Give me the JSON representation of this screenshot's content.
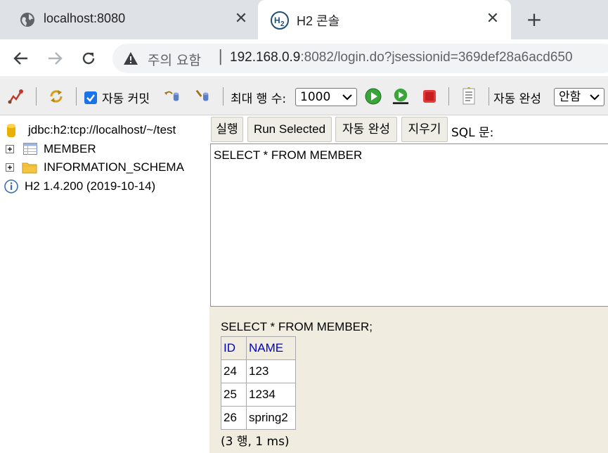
{
  "browser": {
    "tabs": [
      {
        "title": "localhost:8080",
        "icon": "globe-icon",
        "active": false
      },
      {
        "title": "H2 콘솔",
        "icon": "h2-logo-icon",
        "active": true
      }
    ],
    "close_glyph": "✕",
    "new_tab_glyph": "+",
    "security_text": "주의 요함",
    "separator": "|",
    "url_host": "192.168.0.9",
    "url_rest": ":8082/login.do?jsessionid=369def28a6acd650"
  },
  "toolbar": {
    "autocommit_label": "자동 커밋",
    "autocommit_checked": true,
    "max_rows_label": "최대 행 수:",
    "max_rows_value": "1000",
    "autocomplete_label": "자동 완성",
    "autocomplete_value": "안함"
  },
  "tree": {
    "connection": "jdbc:h2:tcp://localhost/~/test",
    "items": [
      {
        "label": "MEMBER",
        "icon": "table-icon"
      },
      {
        "label": "INFORMATION_SCHEMA",
        "icon": "folder-icon"
      }
    ],
    "version": "H2 1.4.200 (2019-10-14)"
  },
  "query": {
    "buttons": {
      "run": "실행",
      "run_selected": "Run Selected",
      "autocomplete": "자동 완성",
      "clear": "지우기"
    },
    "sql_label": "SQL 문:",
    "sql_text": "SELECT * FROM MEMBER"
  },
  "result": {
    "statement": "SELECT * FROM MEMBER;",
    "columns": [
      "ID",
      "NAME"
    ],
    "rows": [
      [
        "24",
        "123"
      ],
      [
        "25",
        "1234"
      ],
      [
        "26",
        "spring2"
      ]
    ],
    "footer": "(3 행, 1 ms)"
  },
  "colors": {
    "tabstrip": "#dee1e6",
    "result_bg": "#f0ede0",
    "header_link": "#0000cc",
    "checkbox": "#1a73e8"
  }
}
